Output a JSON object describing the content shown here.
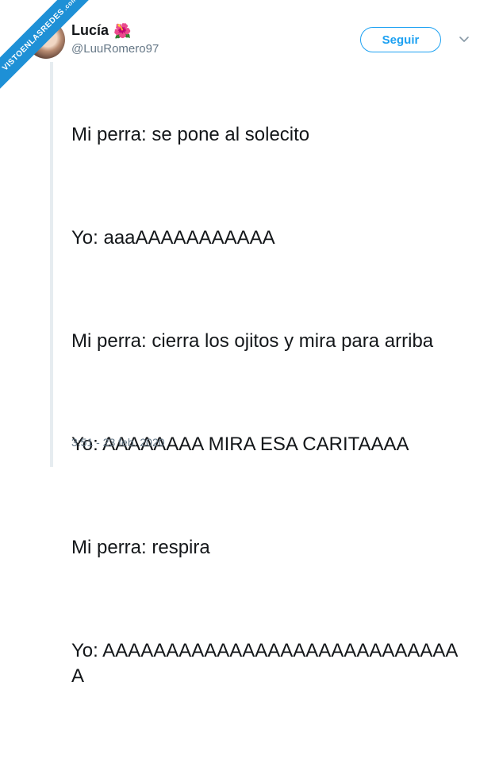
{
  "user": {
    "name": "Lucía",
    "emoji": "🌺",
    "handle": "@LuuRomero97"
  },
  "follow_button": {
    "label": "Seguir"
  },
  "tweet": {
    "paragraphs": [
      "Mi perra: se pone al solecito",
      "Yo: aaaAAAAAAAAAAA",
      "Mi perra: cierra los ojitos y mira para arriba",
      "Yo: AAAAAAAA MIRA ESA CARITAAAA",
      "Mi perra: respira",
      "Yo: AAAAAAAAAAAAAAAAAAAAAAAAAAAAA"
    ],
    "timestamp": "3:51 - 23 feb. 2020"
  },
  "watermark": {
    "main": "VISTOENLASREDES",
    "sub": ".com"
  },
  "colors": {
    "accent": "#1da1f2",
    "muted": "#657786",
    "text": "#14171a",
    "watermark": "#1e90d6"
  },
  "icons": {
    "menu": "chevron-down-icon"
  }
}
